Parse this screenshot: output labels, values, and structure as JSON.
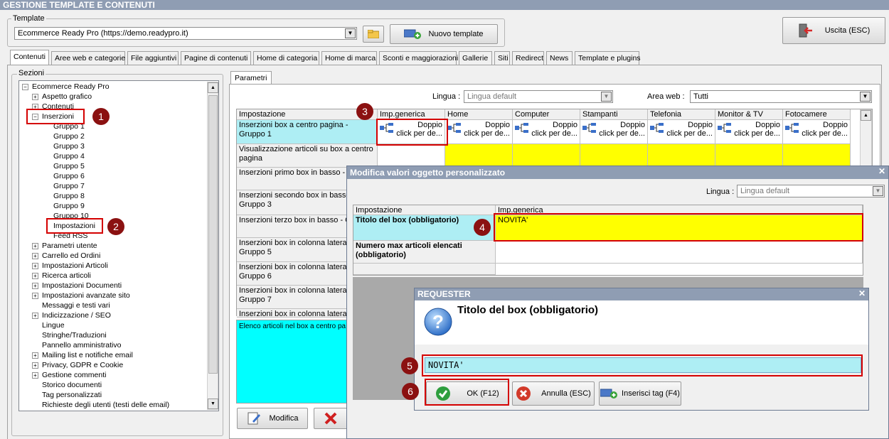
{
  "window": {
    "title": "GESTIONE TEMPLATE E CONTENUTI"
  },
  "template": {
    "group_label": "Template",
    "selected": "Ecommerce Ready Pro (https://demo.readypro.it)",
    "new_button": "Nuovo template",
    "exit_button": "Uscita (ESC)"
  },
  "tabs": [
    "Contenuti",
    "Aree web e categorie",
    "File aggiuntivi",
    "Pagine di contenuti",
    "Home di categoria",
    "Home di marca",
    "Sconti e maggiorazioni",
    "Gallerie",
    "Siti",
    "Redirect",
    "News",
    "Template e plugins"
  ],
  "sections": {
    "label": "Sezioni",
    "root": "Ecommerce Ready Pro",
    "items": [
      {
        "label": "Aspetto grafico",
        "level": 1,
        "exp": "+"
      },
      {
        "label": "Contenuti",
        "level": 1,
        "exp": "+"
      },
      {
        "label": "Inserzioni",
        "level": 1,
        "exp": "−"
      },
      {
        "label": "Gruppo 1",
        "level": 2,
        "exp": ""
      },
      {
        "label": "Gruppo 2",
        "level": 2,
        "exp": ""
      },
      {
        "label": "Gruppo 3",
        "level": 2,
        "exp": ""
      },
      {
        "label": "Gruppo 4",
        "level": 2,
        "exp": ""
      },
      {
        "label": "Gruppo 5",
        "level": 2,
        "exp": ""
      },
      {
        "label": "Gruppo 6",
        "level": 2,
        "exp": ""
      },
      {
        "label": "Gruppo 7",
        "level": 2,
        "exp": ""
      },
      {
        "label": "Gruppo 8",
        "level": 2,
        "exp": ""
      },
      {
        "label": "Gruppo 9",
        "level": 2,
        "exp": ""
      },
      {
        "label": "Gruppo 10",
        "level": 2,
        "exp": ""
      },
      {
        "label": "Impostazioni",
        "level": 2,
        "exp": ""
      },
      {
        "label": "Feed RSS",
        "level": 2,
        "exp": ""
      },
      {
        "label": "Parametri utente",
        "level": 1,
        "exp": "+"
      },
      {
        "label": "Carrello ed Ordini",
        "level": 1,
        "exp": "+"
      },
      {
        "label": "Impostazioni Articoli",
        "level": 1,
        "exp": "+"
      },
      {
        "label": "Ricerca articoli",
        "level": 1,
        "exp": "+"
      },
      {
        "label": "Impostazioni Documenti",
        "level": 1,
        "exp": "+"
      },
      {
        "label": "Impostazioni avanzate sito",
        "level": 1,
        "exp": "+"
      },
      {
        "label": "Messaggi e testi vari",
        "level": 1,
        "exp": ""
      },
      {
        "label": "Indicizzazione / SEO",
        "level": 1,
        "exp": "+"
      },
      {
        "label": "Lingue",
        "level": 1,
        "exp": ""
      },
      {
        "label": "Stringhe/Traduzioni",
        "level": 1,
        "exp": ""
      },
      {
        "label": "Pannello amministrativo",
        "level": 1,
        "exp": ""
      },
      {
        "label": "Mailing list e notifiche email",
        "level": 1,
        "exp": "+"
      },
      {
        "label": "Privacy, GDPR e Cookie",
        "level": 1,
        "exp": "+"
      },
      {
        "label": "Gestione commenti",
        "level": 1,
        "exp": "+"
      },
      {
        "label": "Storico documenti",
        "level": 1,
        "exp": ""
      },
      {
        "label": "Tag personalizzati",
        "level": 1,
        "exp": ""
      },
      {
        "label": "Richieste degli utenti (testi delle email)",
        "level": 1,
        "exp": ""
      }
    ]
  },
  "params": {
    "tab": "Parametri",
    "lingua_label": "Lingua :",
    "lingua_value": "Lingua default",
    "area_label": "Area web :",
    "area_value": "Tutti",
    "columns": [
      "Impostazione",
      "Imp.generica",
      "Home",
      "Computer",
      "Stampanti",
      "Telefonia",
      "Monitor & TV",
      "Fotocamere"
    ],
    "cell_line1": "Doppio",
    "cell_line2": "click per de...",
    "rows": [
      "Inserzioni box a centro pagina - Gruppo 1",
      "Visualizzazione articoli su box a centro pagina",
      "Inserzioni primo box in basso - G",
      "Inserzioni secondo box in basso Gruppo 3",
      "Inserzioni terzo box in basso - G",
      "Inserzioni box in colonna laterale Gruppo 5",
      "Inserzioni box in colonna laterale Gruppo 6",
      "Inserzioni box in colonna laterale Gruppo 7",
      "Inserzioni box in colonna laterale"
    ],
    "description": "Elenco articoli nel box a centro pa",
    "modify_button": "Modifica"
  },
  "dialog": {
    "title": "Modifica valori oggetto personalizzato",
    "lingua_label": "Lingua :",
    "lingua_value": "Lingua default",
    "col_setting": "Impostazione",
    "col_generic": "Imp.generica",
    "row1_label": "Titolo del box (obbligatorio)",
    "row1_value": "NOVITA'",
    "row2_label": "Numero max articoli elencati (obbligatorio)"
  },
  "requester": {
    "title": "REQUESTER",
    "question": "Titolo del box (obbligatorio)",
    "input_value": "NOVITA'",
    "ok": "OK (F12)",
    "cancel": "Annulla (ESC)",
    "insert_tag": "Inserisci tag (F4)"
  },
  "steps": [
    "1",
    "2",
    "3",
    "4",
    "5",
    "6"
  ],
  "colors": {
    "highlight_red": "#d40000",
    "badge": "#8b1111",
    "yellow": "#ffff00",
    "cyan": "#00ffff",
    "titlebar": "#8f9db3"
  }
}
